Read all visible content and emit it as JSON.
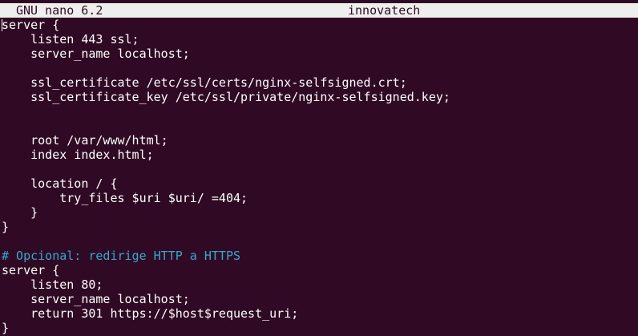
{
  "window": {
    "app_version": "GNU nano 6.2",
    "file_name": "innovatech"
  },
  "colors": {
    "background": "#300a24",
    "text": "#ffffff",
    "titlebar_bg": "#eeeeec",
    "comment": "#34a8cf"
  },
  "editor": {
    "lines": [
      {
        "text": "server {",
        "type": "code"
      },
      {
        "text": "    listen 443 ssl;",
        "type": "code"
      },
      {
        "text": "    server_name localhost;",
        "type": "code"
      },
      {
        "text": "",
        "type": "code"
      },
      {
        "text": "    ssl_certificate /etc/ssl/certs/nginx-selfsigned.crt;",
        "type": "code"
      },
      {
        "text": "    ssl_certificate_key /etc/ssl/private/nginx-selfsigned.key;",
        "type": "code"
      },
      {
        "text": "",
        "type": "code"
      },
      {
        "text": "",
        "type": "code"
      },
      {
        "text": "    root /var/www/html;",
        "type": "code"
      },
      {
        "text": "    index index.html;",
        "type": "code"
      },
      {
        "text": "",
        "type": "code"
      },
      {
        "text": "    location / {",
        "type": "code"
      },
      {
        "text": "        try_files $uri $uri/ =404;",
        "type": "code"
      },
      {
        "text": "    }",
        "type": "code"
      },
      {
        "text": "}",
        "type": "code"
      },
      {
        "text": "",
        "type": "code"
      },
      {
        "text": "# Opcional: redirige HTTP a HTTPS",
        "type": "comment"
      },
      {
        "text": "server {",
        "type": "code"
      },
      {
        "text": "    listen 80;",
        "type": "code"
      },
      {
        "text": "    server_name localhost;",
        "type": "code"
      },
      {
        "text": "    return 301 https://$host$request_uri;",
        "type": "code"
      },
      {
        "text": "}",
        "type": "code"
      }
    ]
  }
}
